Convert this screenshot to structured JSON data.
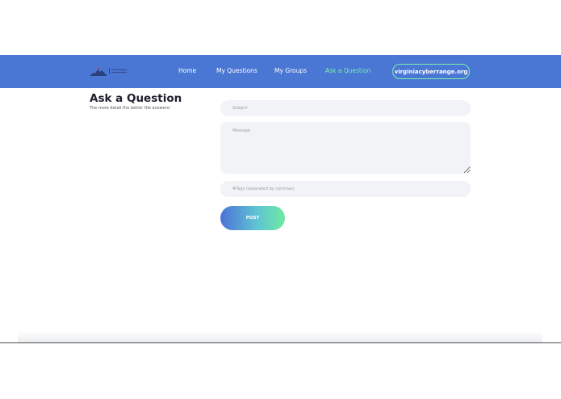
{
  "nav": {
    "home": "Home",
    "my_questions": "My Questions",
    "my_groups": "My Groups",
    "ask_question": "Ask a Question",
    "site_link": "virginiacyberrange.org"
  },
  "main": {
    "title": "Ask a Question",
    "subtitle": "The more detail the better the answers!"
  },
  "form": {
    "subject_placeholder": "Subject",
    "message_placeholder": "Message",
    "tags_placeholder": "#Tags (separated by commas)",
    "subject_value": "",
    "message_value": "",
    "tags_value": "",
    "post_label": "POST"
  },
  "colors": {
    "nav_bg": "#4a76d4",
    "accent": "#7df0b0",
    "field_bg": "#f1f3f6"
  },
  "icons": {
    "logo": "virginia-cyber-range-logo"
  }
}
